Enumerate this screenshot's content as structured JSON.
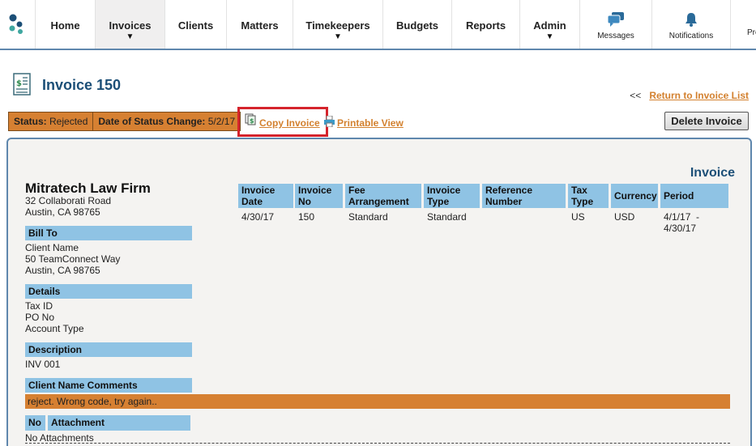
{
  "nav": {
    "items": [
      {
        "label": "Home"
      },
      {
        "label": "Invoices",
        "arrow": "▼"
      },
      {
        "label": "Clients"
      },
      {
        "label": "Matters"
      },
      {
        "label": "Timekeepers",
        "arrow": "▼"
      },
      {
        "label": "Budgets"
      },
      {
        "label": "Reports"
      },
      {
        "label": "Admin",
        "arrow": "▼"
      }
    ],
    "messages_label": "Messages",
    "notifications_label": "Notifications",
    "preferences_label_partial": "Pre",
    "accent": "#5f87ad"
  },
  "header": {
    "title": "Invoice 150",
    "return_prefix": "<<",
    "return_link": "Return to Invoice List"
  },
  "status": {
    "status_label": "Status:",
    "status_value": "Rejected",
    "date_label": "Date of Status Change:",
    "date_value": "5/2/17",
    "color": "#d68032"
  },
  "actions": {
    "copy_invoice": "Copy Invoice",
    "printable_view": "Printable View",
    "delete_invoice": "Delete Invoice"
  },
  "invoice": {
    "heading": "Invoice",
    "firm_name": "Mitratech Law Firm",
    "firm_address_1": "32 Collaborati Road",
    "firm_address_2": "Austin, CA 98765",
    "bill_to_label": "Bill To",
    "bill_to_name": "Client Name",
    "bill_to_address_1": "50 TeamConnect Way",
    "bill_to_address_2": "Austin, CA 98765",
    "details_label": "Details",
    "details_lines": [
      "Tax ID",
      "PO No",
      "Account Type"
    ],
    "description_label": "Description",
    "description_value": "INV 001",
    "comments_label": "Client Name Comments",
    "comments_value": "reject. Wrong code, try again..",
    "attachment_no_label": "No",
    "attachment_label": "Attachment",
    "no_attachments": "No Attachments",
    "table": {
      "headers": [
        [
          "Invoice",
          "Date"
        ],
        [
          "Invoice",
          "No"
        ],
        [
          "Fee",
          "Arrangement"
        ],
        [
          "Invoice",
          "Type"
        ],
        [
          "Reference",
          "Number"
        ],
        [
          "Tax",
          "Type"
        ],
        [
          "Currency",
          ""
        ],
        [
          "Period",
          ""
        ]
      ],
      "row": [
        "4/30/17",
        "150",
        "Standard",
        "Standard",
        "",
        "US",
        "USD",
        "4/1/17  -",
        "4/30/17"
      ]
    }
  }
}
